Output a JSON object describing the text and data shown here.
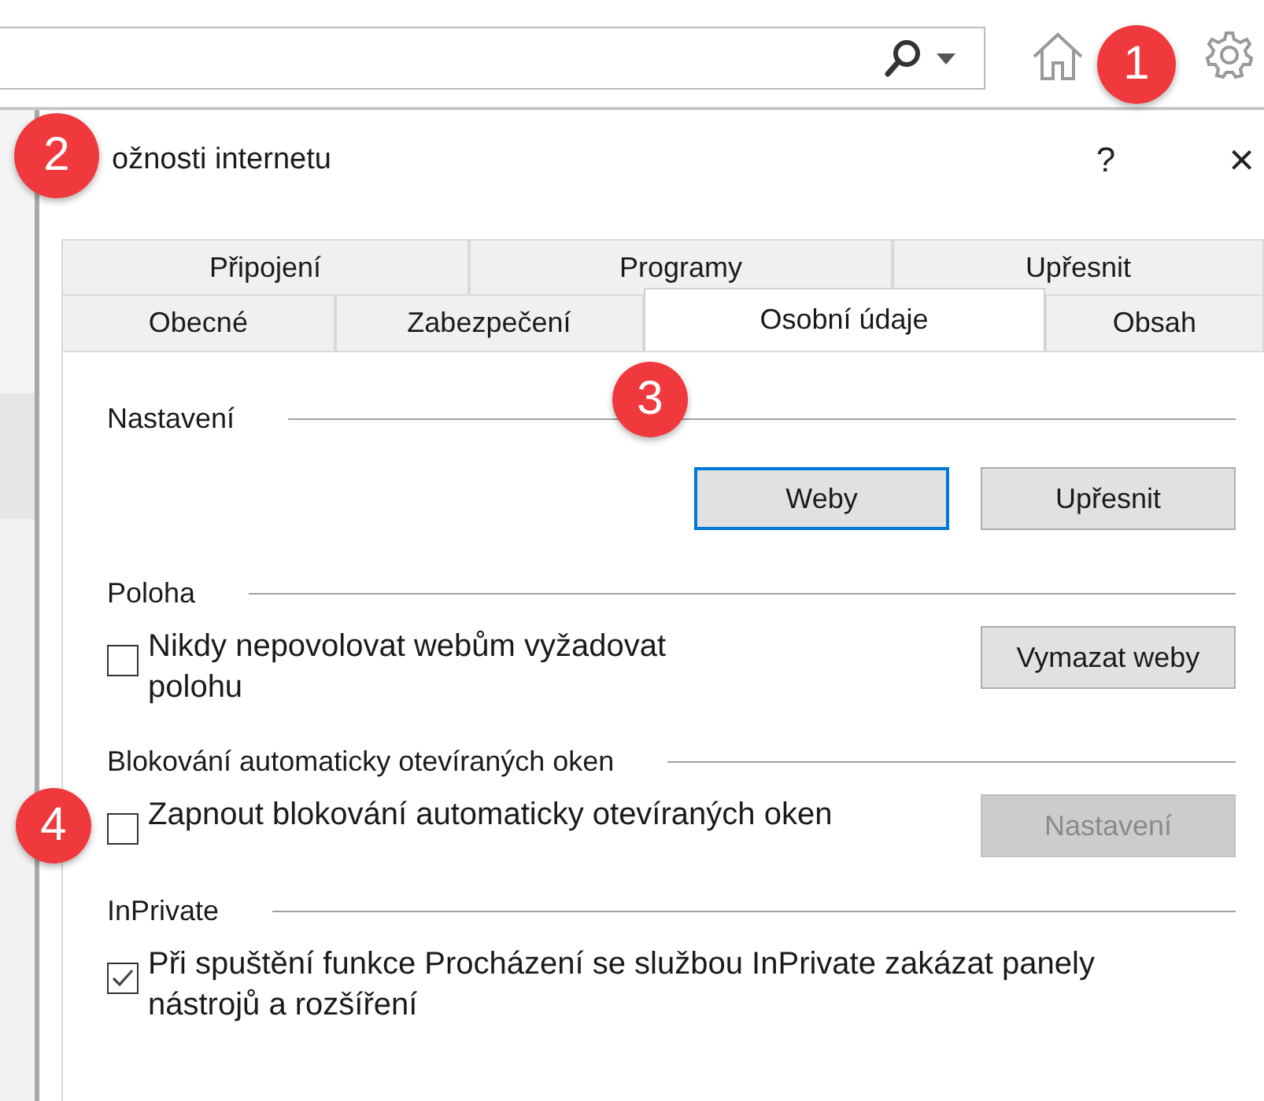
{
  "browser_toolbar": {
    "badge": "1"
  },
  "dialog": {
    "title": "ožnosti internetu",
    "badge": "2",
    "help": "?",
    "close": "×",
    "tab_rows": [
      [
        {
          "label": "Připojení",
          "selected": false
        },
        {
          "label": "Programy",
          "selected": false
        },
        {
          "label": "Upřesnit",
          "selected": false
        }
      ],
      [
        {
          "label": "Obecné",
          "selected": false
        },
        {
          "label": "Zabezpečení",
          "selected": false
        },
        {
          "label": "Osobní údaje",
          "selected": true,
          "badge": "3"
        },
        {
          "label": "Obsah",
          "selected": false
        }
      ]
    ],
    "sections": [
      {
        "title": "Nastavení",
        "rows": [
          {
            "kind": "buttons",
            "buttons": [
              {
                "label": "Weby",
                "focused": true
              },
              {
                "label": "Upřesnit",
                "focused": false
              }
            ]
          }
        ]
      },
      {
        "title": "Poloha",
        "rows": [
          {
            "kind": "checkbox",
            "label": "Nikdy nepovolovat webům vyžadovat polohu",
            "checked": false,
            "button": {
              "label": "Vymazat weby",
              "disabled": false
            }
          }
        ]
      },
      {
        "title": "Blokování automaticky otevíraných oken",
        "rows": [
          {
            "kind": "checkbox",
            "label": "Zapnout blokování automaticky otevíraných oken",
            "checked": false,
            "badge": "4",
            "button": {
              "label": "Nastavení",
              "disabled": true
            }
          }
        ]
      },
      {
        "title": "InPrivate",
        "rows": [
          {
            "kind": "checkbox",
            "label": "Při spuštění funkce Procházení se službou InPrivate zakázat panely nástrojů a rozšíření",
            "checked": true
          }
        ]
      }
    ]
  }
}
